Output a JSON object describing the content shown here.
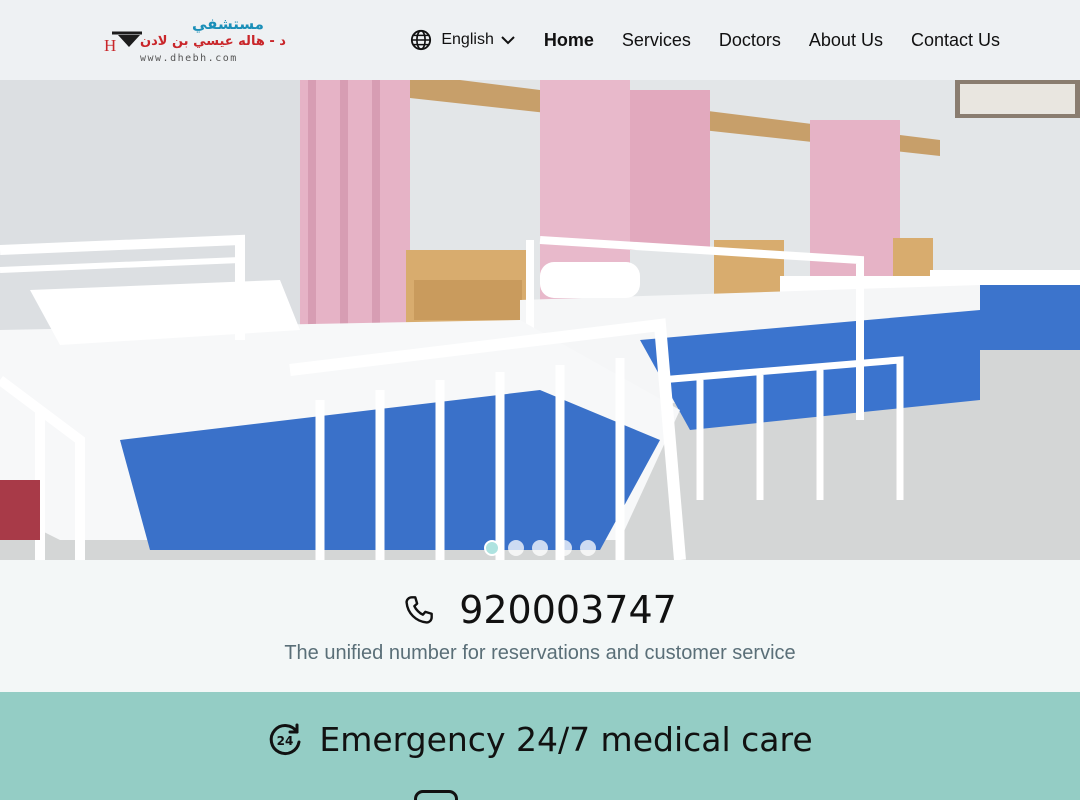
{
  "header": {
    "logo": {
      "arabic_line1": "مستشفي",
      "arabic_line2": "د - هاله عيسي بن لادن",
      "website": "www.dhebh.com",
      "icon": "hospital-logo-icon"
    },
    "language": {
      "label": "English",
      "icon": "globe-icon",
      "dropdown_icon": "chevron-down-icon"
    },
    "nav": [
      {
        "label": "Home",
        "active": true
      },
      {
        "label": "Services"
      },
      {
        "label": "Doctors"
      },
      {
        "label": "About Us"
      },
      {
        "label": "Contact Us"
      }
    ]
  },
  "hero": {
    "slides_total": 5,
    "active_slide": 1
  },
  "contact": {
    "phone_icon": "phone-icon",
    "phone": "920003747",
    "subtitle": "The unified number for reservations and customer service"
  },
  "emergency": {
    "icon": "24-hours-icon",
    "text": "Emergency 24/7 medical care"
  },
  "colors": {
    "header_bg": "#eef1f3",
    "emergency_bg": "#94cdc5",
    "subtitle_text": "#5a6f78",
    "logo_red": "#c9262a",
    "logo_blue": "#1a8fb8"
  }
}
